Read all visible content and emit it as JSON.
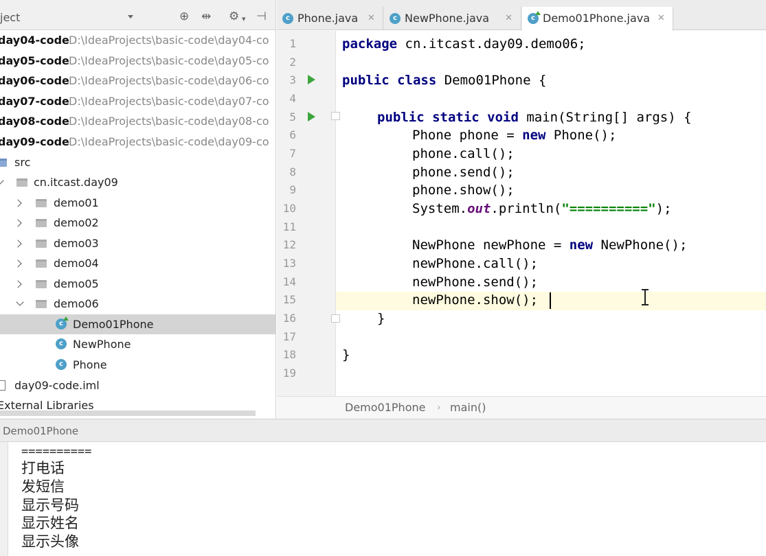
{
  "project_panel": {
    "title": "ject",
    "modules": [
      {
        "name": "day04-code",
        "path": "D:\\IdeaProjects\\basic-code\\day04-co"
      },
      {
        "name": "day05-code",
        "path": "D:\\IdeaProjects\\basic-code\\day05-co"
      },
      {
        "name": "day06-code",
        "path": "D:\\IdeaProjects\\basic-code\\day06-co"
      },
      {
        "name": "day07-code",
        "path": "D:\\IdeaProjects\\basic-code\\day07-co"
      },
      {
        "name": "day08-code",
        "path": "D:\\IdeaProjects\\basic-code\\day08-co"
      },
      {
        "name": "day09-code",
        "path": "D:\\IdeaProjects\\basic-code\\day09-co"
      }
    ],
    "src": "src",
    "package": "cn.itcast.day09",
    "packages": [
      "demo01",
      "demo02",
      "demo03",
      "demo04",
      "demo05",
      "demo06"
    ],
    "classes": [
      "Demo01Phone",
      "NewPhone",
      "Phone"
    ],
    "iml": "day09-code.iml",
    "external_libraries": "External Libraries"
  },
  "tabs": [
    {
      "label": "Phone.java",
      "active": false
    },
    {
      "label": "NewPhone.java",
      "active": false
    },
    {
      "label": "Demo01Phone.java",
      "active": true
    }
  ],
  "editor": {
    "line_numbers": [
      "1",
      "2",
      "3",
      "4",
      "5",
      "6",
      "7",
      "8",
      "9",
      "10",
      "11",
      "12",
      "13",
      "14",
      "15",
      "16",
      "17",
      "18",
      "19"
    ],
    "current_line": 15,
    "code": {
      "l1_kw": "package",
      "l1_rest": " cn.itcast.day09.demo06;",
      "l3_kw": "public class",
      "l3_rest": " Demo01Phone {",
      "l5_kw": "public static void",
      "l5_rest": " main(String[] args) {",
      "l6_a": "Phone phone = ",
      "l6_kw": "new",
      "l6_b": " Phone();",
      "l7": "phone.call();",
      "l8": "phone.send();",
      "l9": "phone.show();",
      "l10_a": "System.",
      "l10_fld": "out",
      "l10_b": ".println(",
      "l10_str": "\"==========\"",
      "l10_c": ");",
      "l12_a": "NewPhone newPhone = ",
      "l12_kw": "new",
      "l12_b": " NewPhone();",
      "l13": "newPhone.call();",
      "l14": "newPhone.send();",
      "l15": "newPhone.show();",
      "l16": "}",
      "l18": "}"
    }
  },
  "breadcrumb": [
    "Demo01Phone",
    "main()"
  ],
  "run_panel": {
    "title": "Demo01Phone",
    "output": [
      "==========",
      "打电话",
      "发短信",
      "显示号码",
      "显示姓名",
      "显示头像"
    ]
  },
  "colors": {
    "keyword": "#000080",
    "string": "#008000",
    "field": "#660e7a",
    "run_icon": "#3ea53e",
    "class_icon": "#4ea0c8",
    "current_line": "#fffbe0"
  }
}
